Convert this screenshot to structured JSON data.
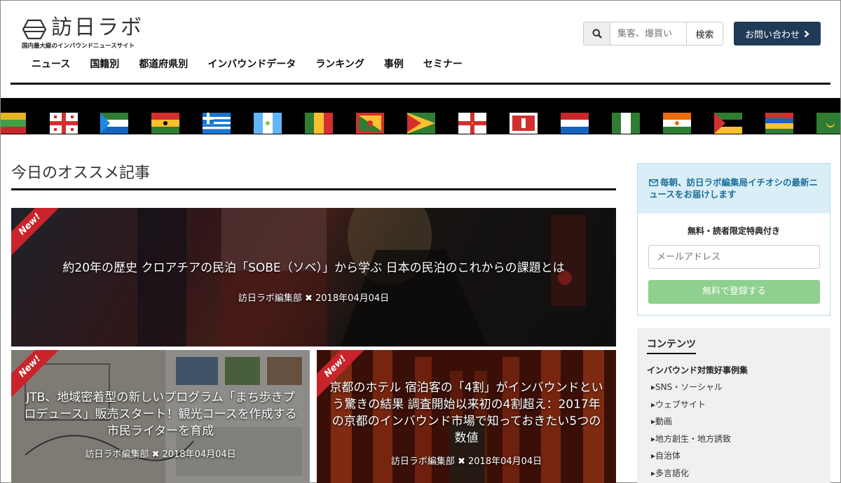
{
  "header": {
    "logo_title": "訪日ラボ",
    "logo_sub": "国内最大級のインバウンドニュースサイト",
    "search_placeholder": "集客、爆買い",
    "search_button": "検索",
    "contact_button": "お問い合わせ",
    "nav": [
      "ニュース",
      "国籍別",
      "都道府県別",
      "インバウンドデータ",
      "ランキング",
      "事例",
      "セミナー"
    ]
  },
  "main": {
    "section_title": "今日のオススメ記事",
    "articles": [
      {
        "new_label": "New!",
        "title": "約20年の歴史 クロアチアの民泊「SOBE（ソベ）」から学ぶ 日本の民泊のこれからの課題とは",
        "author": "訪日ラボ編集部",
        "date": "2018年04月04日"
      },
      {
        "new_label": "New!",
        "title": "JTB、地域密着型の新しいプログラム「まち歩きプロデュース」販売スタート！観光コースを作成する市民ライターを育成",
        "author": "訪日ラボ編集部",
        "date": "2018年04月04日"
      },
      {
        "new_label": "New!",
        "title": "京都のホテル 宿泊客の「4割」がインバウンドという驚きの結果 調査開始以来初の4割超え：2017年の京都のインバウンド市場で知っておきたい5つの数値",
        "author": "訪日ラボ編集部",
        "date": "2018年04月04日"
      }
    ]
  },
  "sidebar": {
    "subscribe_head": "毎朝、訪日ラボ編集局イチオシの最新ニュースをお届けします",
    "subscribe_note": "無料・読者限定特典付き",
    "email_placeholder": "メールアドレス",
    "register_button": "無料で登録する",
    "contents_title": "コンテンツ",
    "contents_sub": "インバウンド対策好事例集",
    "contents_items": [
      "▸SNS・ソーシャル",
      "▸ウェブサイト",
      "▸動画",
      "▸地方創生・地方誘致",
      "▸自治体",
      "▸多言語化"
    ]
  },
  "colors": {
    "accent_navy": "#1f3a57",
    "new_ribbon": "#c9242b",
    "register_green": "#8ed08e",
    "subscribe_blue": "#1d6f99"
  }
}
